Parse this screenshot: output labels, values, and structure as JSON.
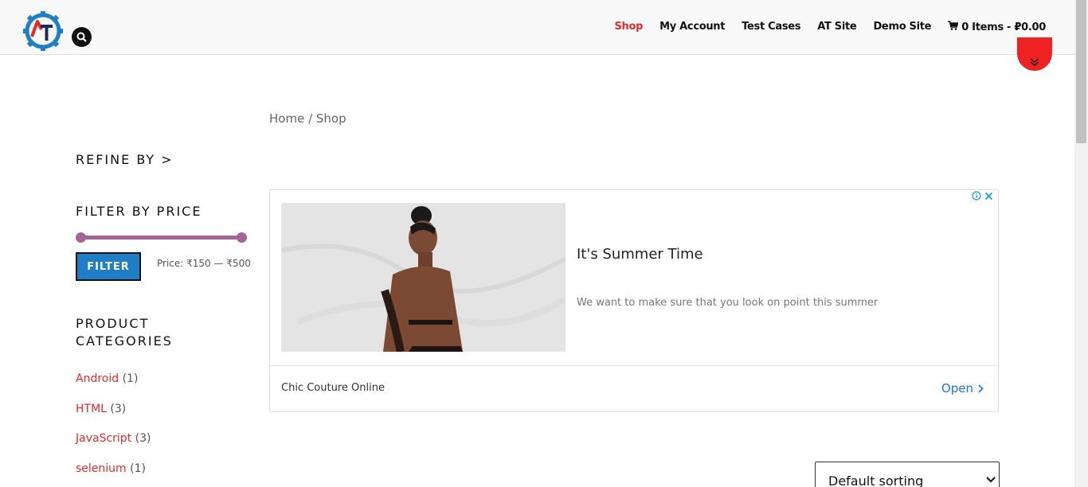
{
  "header": {
    "logo_letters": "AT",
    "nav": [
      {
        "label": "Shop",
        "active": true
      },
      {
        "label": "My Account"
      },
      {
        "label": "Test Cases"
      },
      {
        "label": "AT Site"
      },
      {
        "label": "Demo Site"
      }
    ],
    "cart_label": "0 Items - ₽0.00",
    "accent_color": "#e32b2b"
  },
  "breadcrumb": "Home / Shop",
  "sidebar": {
    "refine_title": "REFINE BY >",
    "filter_title": "FILTER BY PRICE",
    "filter_button": "FILTER",
    "price_label": "Price: ₹150 — ₹500",
    "price_range": {
      "min": 150,
      "max": 500,
      "low_fraction": 0.0,
      "high_fraction": 1.0
    },
    "categories_title": "PRODUCT CATEGORIES",
    "categories": [
      {
        "name": "Android",
        "count": "(1)"
      },
      {
        "name": "HTML",
        "count": "(3)"
      },
      {
        "name": "JavaScript",
        "count": "(3)"
      },
      {
        "name": "selenium",
        "count": "(1)"
      }
    ]
  },
  "ad": {
    "headline": "It's Summer Time",
    "description": "We want to make sure that you look on point this summer",
    "advertiser": "Chic Couture Online",
    "cta": "Open"
  },
  "sorting": {
    "selected": "Default sorting"
  }
}
